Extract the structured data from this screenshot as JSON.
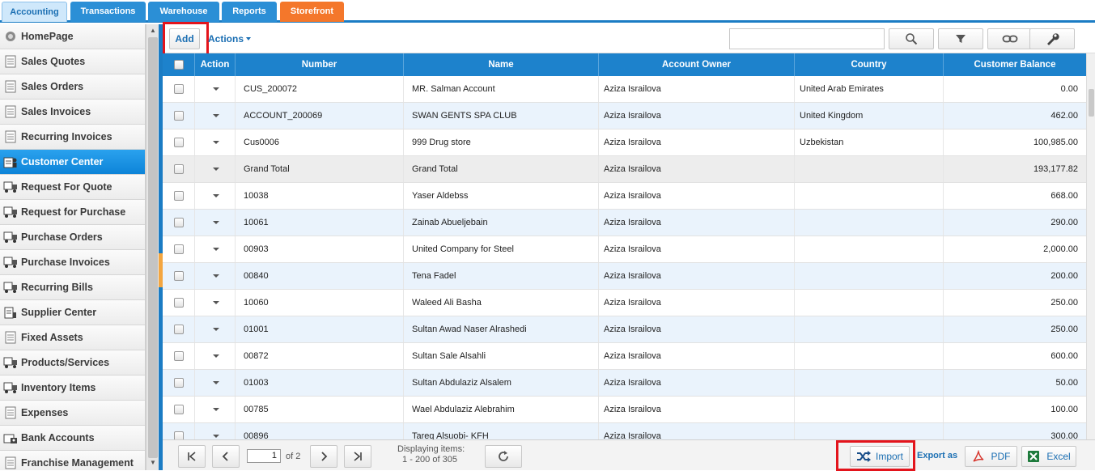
{
  "tabs": [
    {
      "label": "Accounting",
      "active": true
    },
    {
      "label": "Transactions"
    },
    {
      "label": "Warehouse"
    },
    {
      "label": "Reports"
    },
    {
      "label": "Storefront",
      "highlight": "orange"
    }
  ],
  "sidebar": {
    "items": [
      {
        "label": "HomePage",
        "icon": "home-icon"
      },
      {
        "label": "Sales Quotes",
        "icon": "document-icon"
      },
      {
        "label": "Sales Orders",
        "icon": "document-icon"
      },
      {
        "label": "Sales Invoices",
        "icon": "document-icon"
      },
      {
        "label": "Recurring Invoices",
        "icon": "document-icon"
      },
      {
        "label": "Customer Center",
        "icon": "customer-icon",
        "active": true
      },
      {
        "label": "Request For Quote",
        "icon": "truck-icon"
      },
      {
        "label": "Request for Purchase",
        "icon": "truck-icon"
      },
      {
        "label": "Purchase Orders",
        "icon": "truck-icon"
      },
      {
        "label": "Purchase Invoices",
        "icon": "truck-icon"
      },
      {
        "label": "Recurring Bills",
        "icon": "truck-icon"
      },
      {
        "label": "Supplier Center",
        "icon": "supplier-icon"
      },
      {
        "label": "Fixed Assets",
        "icon": "document-icon"
      },
      {
        "label": "Products/Services",
        "icon": "truck-icon"
      },
      {
        "label": "Inventory Items",
        "icon": "truck-icon"
      },
      {
        "label": "Expenses",
        "icon": "document-icon"
      },
      {
        "label": "Bank Accounts",
        "icon": "bank-icon"
      },
      {
        "label": "Franchise Management",
        "icon": "document-icon"
      }
    ]
  },
  "toolbar": {
    "add_label": "Add",
    "actions_label": "Actions",
    "search_placeholder": "",
    "icons": [
      "search-icon",
      "filter-icon",
      "link-icon",
      "wrench-icon"
    ]
  },
  "grid": {
    "columns": [
      "",
      "Action",
      "Number",
      "Name",
      "Account Owner",
      "Country",
      "Customer Balance"
    ],
    "rows": [
      {
        "number": "CUS_200072",
        "name": "MR. Salman Account",
        "owner": "Aziza Israilova",
        "country": "United Arab Emirates",
        "balance": "0.00"
      },
      {
        "number": "ACCOUNT_200069",
        "name": "SWAN GENTS SPA CLUB",
        "owner": "Aziza Israilova",
        "country": "United Kingdom",
        "balance": "462.00"
      },
      {
        "number": "Cus0006",
        "name": "999 Drug store",
        "owner": "Aziza Israilova",
        "country": "Uzbekistan",
        "balance": "100,985.00"
      },
      {
        "number": "Grand Total",
        "name": "Grand Total",
        "owner": "Aziza Israilova",
        "country": "",
        "balance": "193,177.82",
        "total": true
      },
      {
        "number": "10038",
        "name": "Yaser Aldebss",
        "owner": "Aziza Israilova",
        "country": "",
        "balance": "668.00"
      },
      {
        "number": "10061",
        "name": "Zainab Abueljebain",
        "owner": "Aziza Israilova",
        "country": "",
        "balance": "290.00"
      },
      {
        "number": "00903",
        "name": "United Company for Steel",
        "owner": "Aziza Israilova",
        "country": "",
        "balance": "2,000.00"
      },
      {
        "number": "00840",
        "name": "Tena Fadel",
        "owner": "Aziza Israilova",
        "country": "",
        "balance": "200.00"
      },
      {
        "number": "10060",
        "name": "Waleed Ali Basha",
        "owner": "Aziza Israilova",
        "country": "",
        "balance": "250.00"
      },
      {
        "number": "01001",
        "name": "Sultan Awad Naser Alrashedi",
        "owner": "Aziza Israilova",
        "country": "",
        "balance": "250.00"
      },
      {
        "number": "00872",
        "name": "Sultan Sale Alsahli",
        "owner": "Aziza Israilova",
        "country": "",
        "balance": "600.00"
      },
      {
        "number": "01003",
        "name": "Sultan Abdulaziz Alsalem",
        "owner": "Aziza Israilova",
        "country": "",
        "balance": "50.00"
      },
      {
        "number": "00785",
        "name": "Wael Abdulaziz Alebrahim",
        "owner": "Aziza Israilova",
        "country": "",
        "balance": "100.00"
      },
      {
        "number": "00896",
        "name": "Tareq Alsuobi- KFH",
        "owner": "Aziza Israilova",
        "country": "",
        "balance": "300.00"
      }
    ]
  },
  "pager": {
    "page": "1",
    "of_label": "of",
    "total_pages": "2",
    "displaying_label": "Displaying items:",
    "displaying_range": "1 - 200 of 305",
    "import_label": "Import",
    "export_label": "Export as",
    "pdf_label": "PDF",
    "excel_label": "Excel"
  },
  "colors": {
    "accent": "#1d82cc",
    "active_sidebar": "#1a93e2",
    "highlight_box": "#e3141c",
    "storefront_tab": "#f4772b"
  }
}
